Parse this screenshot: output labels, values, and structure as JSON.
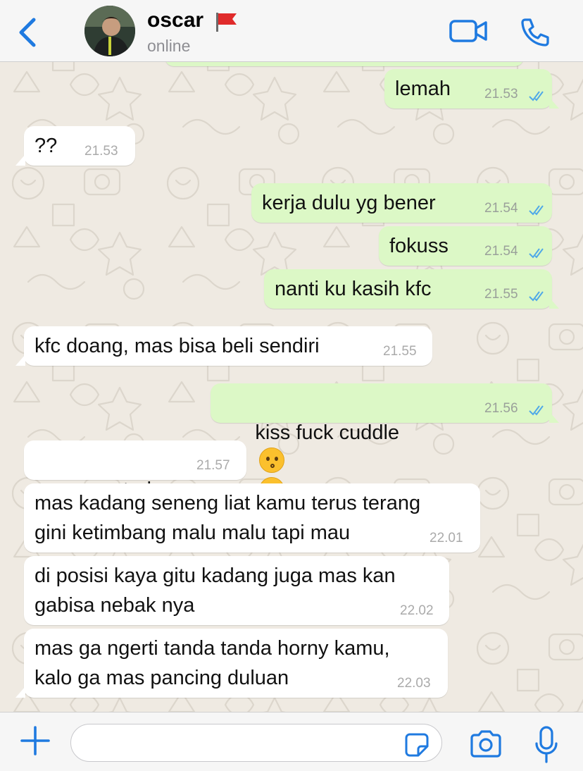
{
  "header": {
    "contact_name": "oscar",
    "status": "online"
  },
  "icons": {
    "back": "chevron-left-icon",
    "flag": "red-flag-icon",
    "video": "video-camera-icon",
    "call": "phone-icon",
    "add": "plus-icon",
    "sticker": "sticker-icon",
    "camera": "camera-icon",
    "mic": "microphone-icon",
    "read": "double-check-icon"
  },
  "colors": {
    "accent": "#1f7ae0",
    "outgoing_bubble": "#dcf8c6",
    "incoming_bubble": "#ffffff",
    "read_ticks": "#4fa8e8"
  },
  "messages": [
    {
      "dir": "out",
      "text": "lemah",
      "time": "21.53"
    },
    {
      "dir": "in",
      "text": "??",
      "time": "21.53"
    },
    {
      "dir": "out",
      "text": "kerja dulu yg bener",
      "time": "21.54"
    },
    {
      "dir": "out",
      "text": "fokuss",
      "time": "21.54"
    },
    {
      "dir": "out",
      "text": "nanti ku kasih kfc",
      "time": "21.55"
    },
    {
      "dir": "in",
      "text": "kfc doang, mas bisa beli sendiri",
      "time": "21.55"
    },
    {
      "dir": "out",
      "text": "kiss fuck cuddle",
      "emoji": "😗 😗",
      "time": "21.56"
    },
    {
      "dir": "in",
      "text": "accepted",
      "emoji": "❤️",
      "time": "21.57"
    },
    {
      "dir": "in",
      "text": "mas kadang seneng liat kamu terus terang\ngini ketimbang malu malu tapi mau",
      "time": "22.01"
    },
    {
      "dir": "in",
      "text": "di posisi kaya gitu kadang juga mas kan\ngabisa nebak nya",
      "time": "22.02"
    },
    {
      "dir": "in",
      "text": "mas ga ngerti tanda tanda horny kamu,\nkalo ga mas pancing duluan",
      "time": "22.03"
    }
  ],
  "composer": {
    "value": "",
    "placeholder": ""
  }
}
